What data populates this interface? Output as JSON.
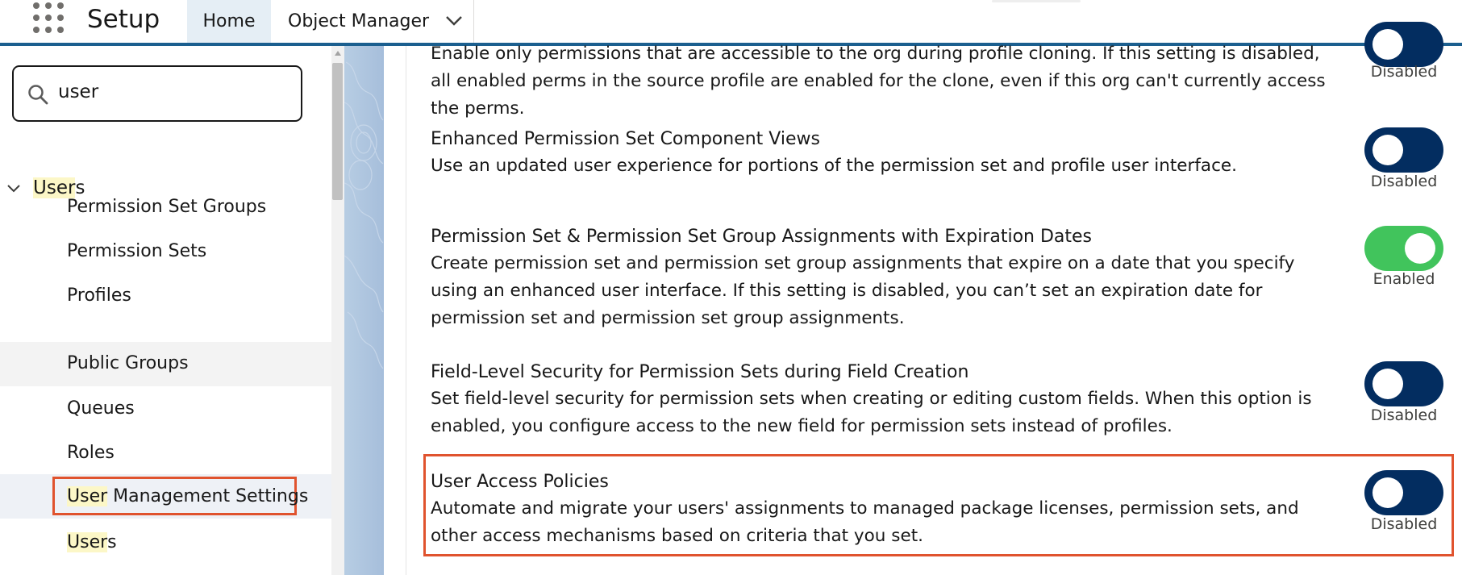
{
  "header": {
    "app_title": "Setup",
    "tabs": [
      {
        "label": "Home"
      },
      {
        "label": "Object Manager"
      }
    ]
  },
  "sidebar": {
    "search": {
      "value": "user"
    },
    "parent": {
      "label_highlight": "User",
      "label_rest": "s"
    },
    "items": [
      {
        "label": "Permission Set Groups"
      },
      {
        "label": "Permission Sets"
      },
      {
        "label": "Profiles"
      },
      {
        "label": "Public Groups"
      },
      {
        "label": "Queues"
      },
      {
        "label": "Roles"
      },
      {
        "label_highlight": "User",
        "label_rest": " Management Settings"
      },
      {
        "label_highlight": "User",
        "label_rest": "s"
      }
    ]
  },
  "settings": [
    {
      "title": "",
      "description": "Enable only permissions that are accessible to the org during profile cloning. If this setting is disabled, all enabled perms in the source profile are enabled for the clone, even if this org can't currently access the perms.",
      "status": "Disabled"
    },
    {
      "title": "Enhanced Permission Set Component Views",
      "description": "Use an updated user experience for portions of the permission set and profile user interface.",
      "status": "Disabled"
    },
    {
      "title": "Permission Set & Permission Set Group Assignments with Expiration Dates",
      "description": "Create permission set and permission set group assignments that expire on a date that you specify using an enhanced user interface. If this setting is disabled, you can’t set an expiration date for permission set and permission set group assignments.",
      "status": "Enabled"
    },
    {
      "title": "Field-Level Security for Permission Sets during Field Creation",
      "description": "Set field-level security for permission sets when creating or editing custom fields. When this option is enabled, you configure access to the new field for permission sets instead of profiles.",
      "status": "Disabled"
    },
    {
      "title": "User Access Policies",
      "description": "Automate and migrate your users' assignments to managed package licenses, permission sets, and other access mechanisms based on criteria that you set.",
      "status": "Disabled"
    }
  ],
  "colors": {
    "toggle_off": "#032d60",
    "toggle_on": "#41c45c",
    "highlight_box": "#e0532e",
    "search_highlight": "#fcf7c7"
  },
  "icons": [
    "app-launcher-icon",
    "chevron-down-icon",
    "search-icon"
  ]
}
